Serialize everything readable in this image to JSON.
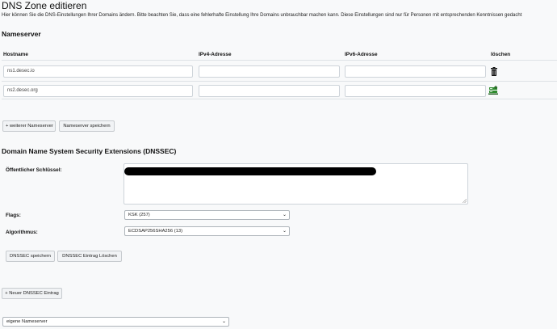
{
  "page": {
    "title": "DNS Zone editieren",
    "intro": "Hier können Sie die DNS-Einstellungen Ihrer Domains ändern. Bitte beachten Sie, dass eine fehlerhafte Einstellung Ihre Domains unbrauchbar machen kann. Diese Einstellungen sind nur für Personen mit entsprechenden Kenntnissen gedacht"
  },
  "nameserver": {
    "heading": "Nameserver",
    "columns": {
      "hostname": "Hostname",
      "ipv4": "IPv4-Adresse",
      "ipv6": "IPv6-Adresse",
      "delete": "löschen"
    },
    "rows": [
      {
        "hostname": "ns1.desec.io",
        "ipv4": "",
        "ipv6": "",
        "action_icon": "trash-icon"
      },
      {
        "hostname": "ns2.desec.org",
        "ipv4": "",
        "ipv6": "",
        "action_icon": "add-server-icon"
      }
    ],
    "add_button": "+ weiterer Nameserver",
    "save_button": "Nameserver speichern"
  },
  "dnssec": {
    "heading": "Domain Name System Security Extensions (DNSSEC)",
    "public_key_label": "Öffentlicher Schlüssel:",
    "flags_label": "Flags:",
    "flags_value": "KSK (257)",
    "algorithm_label": "Algorithmus:",
    "algorithm_value": "ECDSAP256SHA256 (13)",
    "save_button": "DNSSEC speichern",
    "delete_button": "DNSSEC Eintrag Löschen",
    "new_button": "+ Neuer DNSSEC Eintrag"
  },
  "nameserver_mode": {
    "value": "eigene Nameserver"
  },
  "colors": {
    "icon_green": "#2e8b2e",
    "page_bg": "#f8f9fa"
  }
}
